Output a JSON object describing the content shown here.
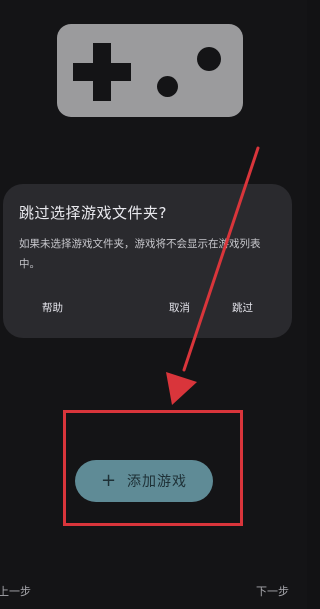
{
  "dialog": {
    "title": "跳过选择游戏文件夹?",
    "message": "如果未选择游戏文件夹，游戏将不会显示在游戏列表中。",
    "help_label": "帮助",
    "cancel_label": "取消",
    "skip_label": "跳过"
  },
  "add_game": {
    "plus": "+",
    "label": "添加游戏"
  },
  "nav": {
    "prev_label": "上一步",
    "next_label": "下一步"
  },
  "colors": {
    "background": "#141416",
    "dialog": "#2a2a2e",
    "accent_button": "#5f8b96",
    "annotation": "#d9353b",
    "gamepad": "#9b9b9d"
  },
  "icons": {
    "illustration": "gamepad-icon",
    "add": "plus-icon"
  }
}
